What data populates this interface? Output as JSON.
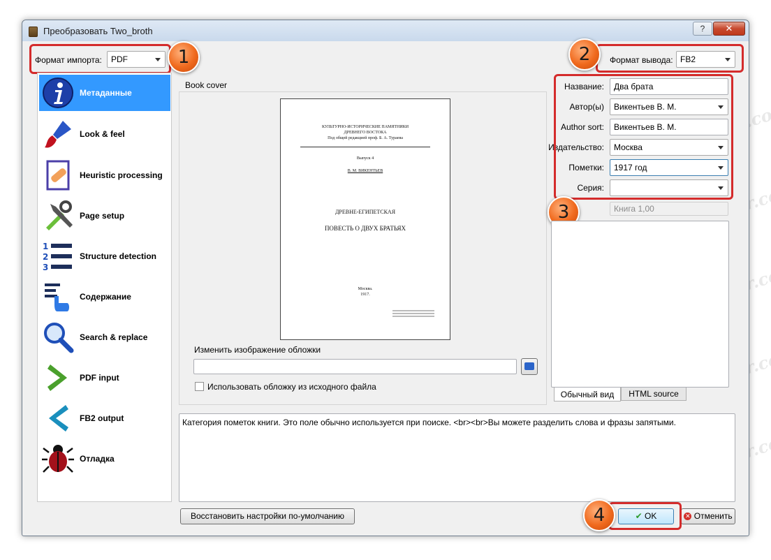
{
  "window": {
    "title": "Преобразовать Two_broth",
    "help_label": "?",
    "close_label": "✕"
  },
  "import": {
    "label": "Формат импорта:",
    "value": "PDF"
  },
  "output": {
    "label": "Формат вывода:",
    "value": "FB2"
  },
  "callouts": [
    "1",
    "2",
    "3",
    "4"
  ],
  "accent_color": "#d42b2b",
  "sidebar": {
    "selected_index": 0,
    "items": [
      {
        "label": "Метаданные",
        "icon": "info-icon"
      },
      {
        "label": "Look & feel",
        "icon": "brush-icon"
      },
      {
        "label": "Heuristic processing",
        "icon": "document-bandage-icon"
      },
      {
        "label": "Page setup",
        "icon": "tools-icon"
      },
      {
        "label": "Structure detection",
        "icon": "numbered-list-icon"
      },
      {
        "label": "Содержание",
        "icon": "toc-hand-icon"
      },
      {
        "label": "Search & replace",
        "icon": "magnifier-icon"
      },
      {
        "label": "PDF input",
        "icon": "arrow-right-icon"
      },
      {
        "label": "FB2 output",
        "icon": "arrow-left-icon"
      },
      {
        "label": "Отладка",
        "icon": "bug-icon"
      }
    ]
  },
  "cover": {
    "group_title": "Book cover",
    "page": {
      "header1": "КУЛЬТУРНО-ИСТОРИЧЕСКИЕ ПАМЯТНИКИ",
      "header2": "ДРЕВНЕГО ВОСТОКА",
      "header3": "Под общей редакцией проф. Б. А. Тураева",
      "issue": "Выпуск 4",
      "author": "В. М. ВИКЕНТЬЕВ",
      "subtitle": "ДРЕВНЕ-ЕГИПЕТСКАЯ",
      "title": "ПОВЕСТЬ О ДВУХ БРАТЬЯХ",
      "city": "Москва.",
      "year": "1917."
    },
    "change_label": "Изменить изображение обложки",
    "path_value": "",
    "use_source_label": "Использовать обложку из исходного файла",
    "use_source_checked": false
  },
  "metadata": {
    "title_label": "Название:",
    "title_value": "Два брата",
    "author_label": "Автор(ы)",
    "author_value": "Викентьев В. М.",
    "author_sort_label": "Author sort:",
    "author_sort_value": "Викентьев В. М.",
    "publisher_label": "Издательство:",
    "publisher_value": "Москва",
    "tags_label": "Пометки:",
    "tags_value": "1917 год",
    "series_label": "Серия:",
    "series_value": "",
    "series_number": "Книга 1,00"
  },
  "comments_tabs": [
    "Обычный вид",
    "HTML source"
  ],
  "description": "Категория пометок книги.  Это поле обычно используется при поиске. <br><br>Вы можете разделить слова и фразы запятыми.",
  "buttons": {
    "restore_defaults": "Восстановить настройки по-умолчанию",
    "ok": "OK",
    "cancel": "Отменить"
  },
  "watermark_text": "Soringpcrepair.com"
}
